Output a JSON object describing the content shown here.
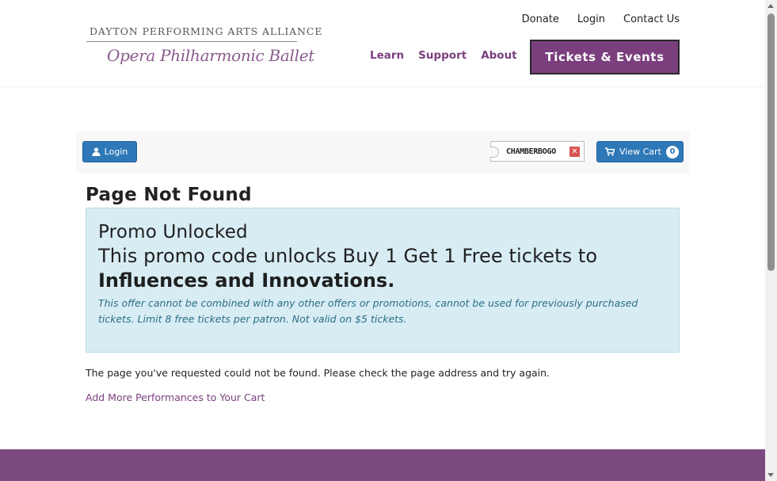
{
  "header": {
    "logo_top": "DAYTON PERFORMING ARTS ALLIANCE",
    "logo_script": "Opera  Philharmonic  Ballet",
    "util_nav": [
      "Donate",
      "Login",
      "Contact Us"
    ],
    "main_nav": [
      "Learn",
      "Support",
      "About"
    ],
    "tickets_button": "Tickets & Events"
  },
  "toolbar": {
    "login_label": "Login",
    "promo_code": "CHAMBERBOGO",
    "promo_remove": "✕",
    "cart_label": "View Cart",
    "cart_count": "0"
  },
  "main": {
    "page_title": "Page Not Found",
    "promo": {
      "heading": "Promo Unlocked",
      "line": "This promo code unlocks Buy 1 Get 1 Free tickets to",
      "bold": "Influences and Innovations.",
      "note": "This offer cannot be combined with any other offers or promotions, cannot be used for previously purchased tickets. Limit 8 free tickets per patron. Not valid on $5 tickets."
    },
    "not_found_text": "The page you've requested could not be found. Please check the page address and try again.",
    "more_link": "Add More Performances to Your Cart"
  },
  "colors": {
    "brand_purple": "#7b3f7e",
    "button_blue": "#2f78b8",
    "promo_bg": "#d8ecf4",
    "footer_purple": "#7b4a80"
  },
  "icons": {
    "login": "user-icon",
    "cart": "cart-icon",
    "remove": "close-icon"
  }
}
